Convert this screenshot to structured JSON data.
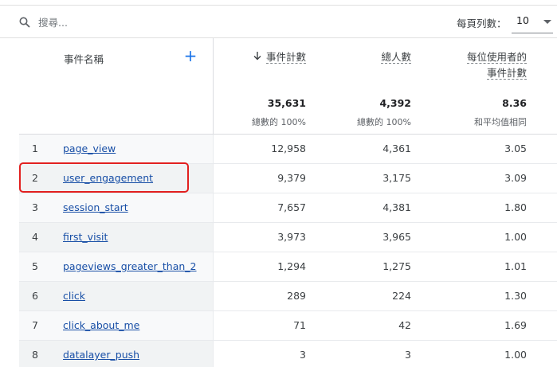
{
  "toolbar": {
    "search_placeholder": "搜尋...",
    "rows_label": "每頁列數：",
    "rows_value": "10"
  },
  "header": {
    "dimension_label": "事件名稱",
    "add_label": "+",
    "metrics": [
      {
        "label": "事件計數",
        "sorted": true
      },
      {
        "label": "總人數",
        "sorted": false
      },
      {
        "label_line1": "每位使用者的",
        "label_line2": "事件計數",
        "sorted": false
      }
    ],
    "totals": [
      {
        "value": "35,631",
        "sub": "總數的 100%"
      },
      {
        "value": "4,392",
        "sub": "總數的 100%"
      },
      {
        "value": "8.36",
        "sub": "和平均值相同"
      }
    ]
  },
  "rows": [
    {
      "idx": "1",
      "name": "page_view",
      "count": "12,958",
      "users": "4,361",
      "per_user": "3.05"
    },
    {
      "idx": "2",
      "name": "user_engagement",
      "count": "9,379",
      "users": "3,175",
      "per_user": "3.09"
    },
    {
      "idx": "3",
      "name": "session_start",
      "count": "7,657",
      "users": "4,381",
      "per_user": "1.80"
    },
    {
      "idx": "4",
      "name": "first_visit",
      "count": "3,973",
      "users": "3,965",
      "per_user": "1.00"
    },
    {
      "idx": "5",
      "name": "pageviews_greater_than_2",
      "count": "1,294",
      "users": "1,275",
      "per_user": "1.01"
    },
    {
      "idx": "6",
      "name": "click",
      "count": "289",
      "users": "224",
      "per_user": "1.30"
    },
    {
      "idx": "7",
      "name": "click_about_me",
      "count": "71",
      "users": "42",
      "per_user": "1.69"
    },
    {
      "idx": "8",
      "name": "datalayer_push",
      "count": "3",
      "users": "3",
      "per_user": "1.00"
    }
  ],
  "colors": {
    "link": "#174ea6",
    "accent": "#1a73e8",
    "highlight": "#e2201f"
  },
  "icons": {
    "search": "search-icon",
    "sort": "arrow-down-icon",
    "dropdown": "caret-down-icon",
    "add": "plus-icon"
  }
}
